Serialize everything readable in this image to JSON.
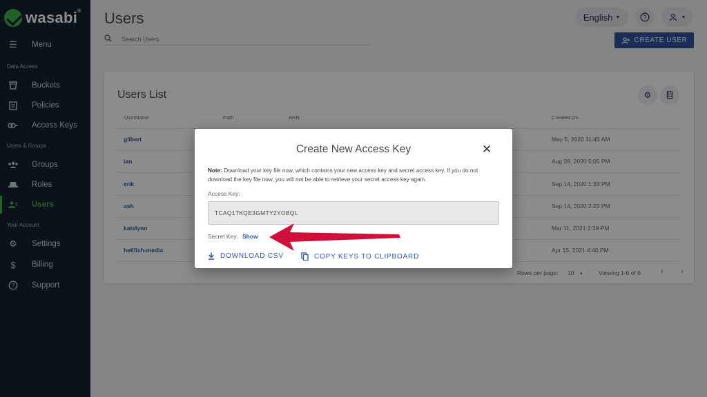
{
  "brand": {
    "name": "wasabi",
    "trademark": "®"
  },
  "sidebar": {
    "menu_label": "Menu",
    "section_data_access": "Data Access",
    "section_users_groups": "Users & Groups",
    "section_your_account": "Your Account",
    "items": [
      {
        "label": "Buckets",
        "icon": "bucket-icon"
      },
      {
        "label": "Policies",
        "icon": "clipboard-icon"
      },
      {
        "label": "Access Keys",
        "icon": "key-icon"
      },
      {
        "label": "Groups",
        "icon": "groups-icon"
      },
      {
        "label": "Roles",
        "icon": "hat-icon"
      },
      {
        "label": "Users",
        "icon": "users-icon",
        "active": true
      },
      {
        "label": "Settings",
        "icon": "gear-icon"
      },
      {
        "label": "Billing",
        "icon": "dollar-icon"
      },
      {
        "label": "Support",
        "icon": "help-icon"
      }
    ]
  },
  "header": {
    "title": "Users",
    "search_placeholder": "Search Users",
    "language": "English",
    "create_user_label": "CREATE USER"
  },
  "users_list": {
    "title": "Users List",
    "columns": [
      "UserName",
      "Path",
      "ARN",
      "Created On"
    ],
    "rows": [
      {
        "username": "gilbert",
        "created": "May 5, 2020 11:45 AM"
      },
      {
        "username": "ian",
        "created": "Aug 28, 2020 5:05 PM"
      },
      {
        "username": "erik",
        "created": "Sep 14, 2020 1:33 PM"
      },
      {
        "username": "ash",
        "created": "Sep 14, 2020 2:23 PM"
      },
      {
        "username": "katelynn",
        "created": "Mar 11, 2021 2:39 PM"
      },
      {
        "username": "hellfish-media",
        "created": "Apr 15, 2021 4:40 PM"
      }
    ],
    "rows_per_page_label": "Rows per page:",
    "rows_per_page_value": "10",
    "viewing": "Viewing 1-6 of 6"
  },
  "modal": {
    "title": "Create New Access Key",
    "note_bold": "Note:",
    "note_text": " Download your key file now, which contains your new access key and secret access key. If you do not download the key file now, you will not be able to retrieve your secret access key again.",
    "access_key_label": "Access Key:",
    "access_key_value": "TCAQ1TKQE3GMTY2YOBQL",
    "secret_key_label": "Secret Key:",
    "secret_key_show": "Show",
    "download_csv": "DOWNLOAD CSV",
    "copy_keys": "COPY KEYS TO CLIPBOARD"
  },
  "colors": {
    "sidebar_bg": "#14222f",
    "brand_green": "#3db249",
    "primary_blue": "#30559e",
    "arrow_red": "#d0103a"
  }
}
